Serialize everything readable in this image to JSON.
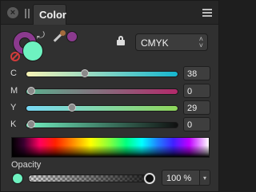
{
  "panel": {
    "tab_label": "Color"
  },
  "fill_color": "#6ef2c0",
  "stroke_color": "#8b3a8e",
  "picked_color": "#8b3a8e",
  "mode_dropdown": {
    "selected": "CMYK"
  },
  "sliders": [
    {
      "label": "C",
      "value": "38",
      "fraction": 0.38,
      "gradient": [
        "#f7f3b6",
        "#15b6cf"
      ]
    },
    {
      "label": "M",
      "value": "0",
      "fraction": 0.0,
      "gradient": [
        "#5ab08e",
        "#b3296b"
      ]
    },
    {
      "label": "Y",
      "value": "29",
      "fraction": 0.29,
      "gradient": [
        "#78d8f5",
        "#8ed65a"
      ]
    },
    {
      "label": "K",
      "value": "0",
      "fraction": 0.0,
      "gradient": [
        "#72eec0",
        "#101010"
      ]
    }
  ],
  "opacity": {
    "label": "Opacity",
    "value": "100 %",
    "fraction": 1.0
  },
  "icons": {
    "close": "close-icon",
    "grip": "grip-icon",
    "menu": "menu-icon",
    "swap": "swap-icon",
    "none": "no-color-icon",
    "picker": "color-picker-icon",
    "lock": "lock-icon",
    "chevron": "chevron-updown-icon"
  }
}
